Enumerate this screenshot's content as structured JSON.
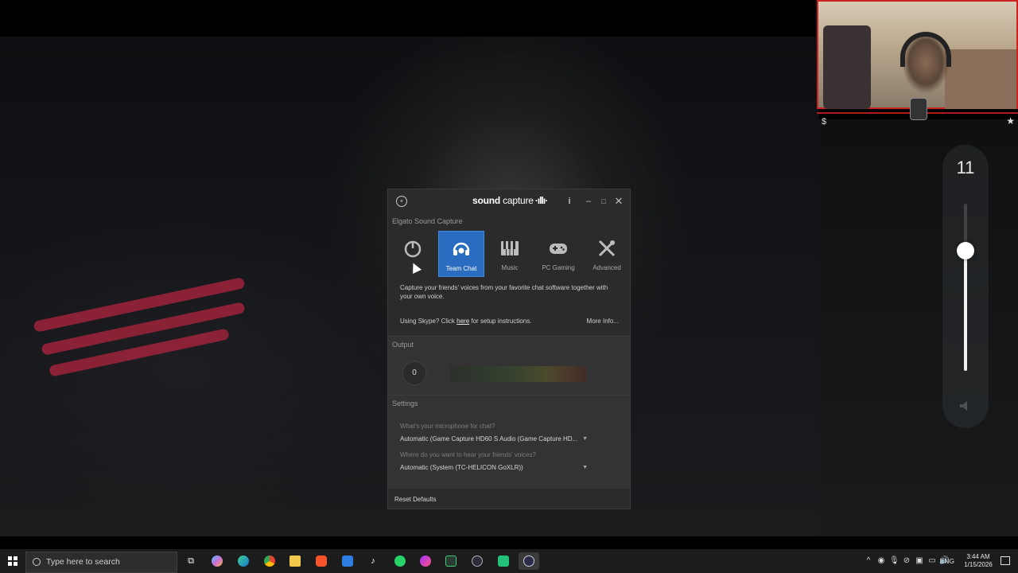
{
  "overlay": {
    "volume_value": "11",
    "volume_level": 0.72
  },
  "app": {
    "brand_main": "sound",
    "brand_sub": " capture",
    "brand_wave": "·ıllı·",
    "section_title": "Elgato Sound Capture",
    "modes": [
      {
        "label": "",
        "icon": "power-icon",
        "active": false
      },
      {
        "label": "Team Chat",
        "icon": "headset-icon",
        "active": true
      },
      {
        "label": "Music",
        "icon": "piano-icon",
        "active": false
      },
      {
        "label": "PC Gaming",
        "icon": "gamepad-icon",
        "active": false
      },
      {
        "label": "Advanced",
        "icon": "tools-icon",
        "active": false
      }
    ],
    "description": "Capture your friends' voices from your favorite chat software together with your own voice.",
    "skype_prefix": "Using Skype? Click ",
    "skype_link": "here",
    "skype_suffix": " for setup instructions.",
    "more_info": "More Info...",
    "output": {
      "title": "Output",
      "value": "0"
    },
    "settings": {
      "title": "Settings",
      "mic_question": "What's your microphone for chat?",
      "mic_value": "Automatic (Game Capture HD60 S Audio (Game Capture HD...",
      "hear_question": "Where do you want to hear your friends' voices?",
      "hear_value": "Automatic (System (TC-HELICON GoXLR))"
    },
    "reset_label": "Reset Defaults"
  },
  "taskbar": {
    "search_placeholder": "Type here to search",
    "lang": "ENG",
    "time": "3:44 AM",
    "date": "1/15/2026",
    "apps": [
      "task-view-icon",
      "copilot-icon",
      "edge-icon",
      "chrome-icon",
      "file-explorer-icon",
      "brave-icon",
      "mail-icon",
      "tiktok-icon",
      "whatsapp-icon",
      "messenger-icon",
      "xbox-icon",
      "media-player-icon",
      "sound-capture-icon",
      "elgato-icon"
    ]
  },
  "colors": {
    "accent": "#2a6dc0",
    "window_bg": "#2b2b2b",
    "taskbar_bg": "#1c1c1c"
  }
}
